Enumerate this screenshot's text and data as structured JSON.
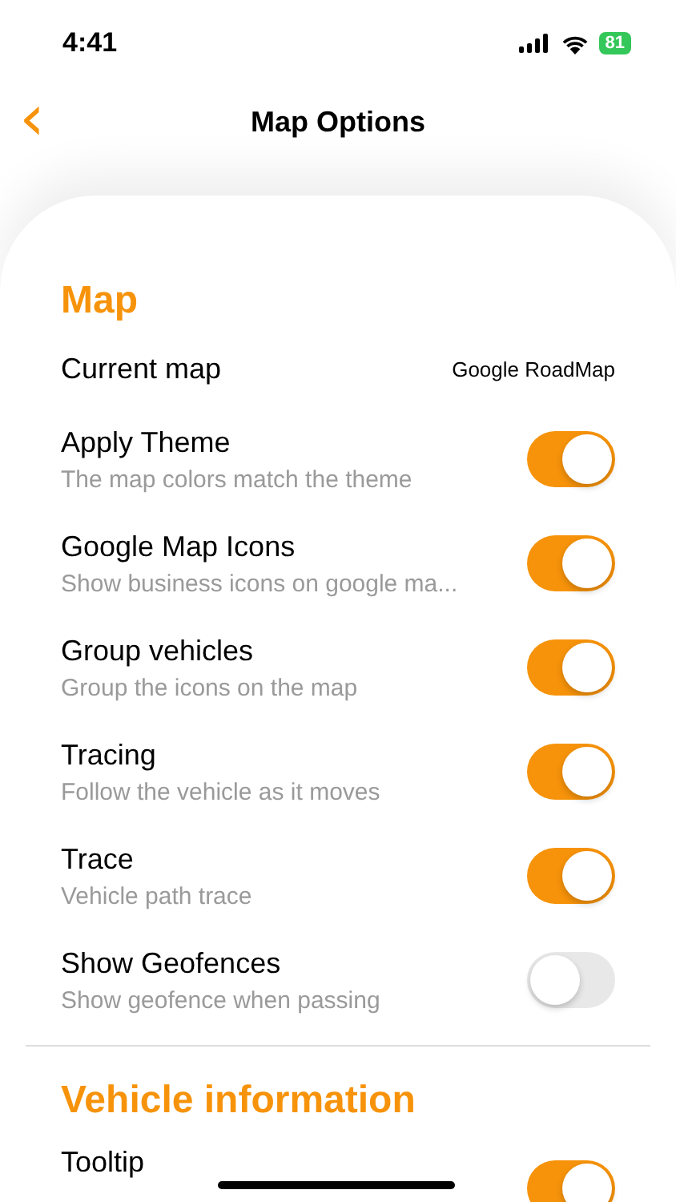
{
  "status_bar": {
    "time": "4:41",
    "battery": "81"
  },
  "nav": {
    "back": "‹",
    "title": "Map Options"
  },
  "sections": [
    {
      "title": "Map",
      "rows": [
        {
          "kind": "value",
          "label": "Current map",
          "value": "Google RoadMap"
        },
        {
          "kind": "toggle",
          "label": "Apply Theme",
          "subtitle": "The map colors match the theme",
          "on": true
        },
        {
          "kind": "toggle",
          "label": "Google Map Icons",
          "subtitle": "Show business icons on google ma...",
          "on": true
        },
        {
          "kind": "toggle",
          "label": "Group vehicles",
          "subtitle": "Group the icons on the map",
          "on": true
        },
        {
          "kind": "toggle",
          "label": "Tracing",
          "subtitle": "Follow the vehicle as it moves",
          "on": true
        },
        {
          "kind": "toggle",
          "label": "Trace",
          "subtitle": "Vehicle path trace",
          "on": true
        },
        {
          "kind": "toggle",
          "label": "Show Geofences",
          "subtitle": "Show geofence when passing",
          "on": false
        }
      ]
    },
    {
      "title": "Vehicle information",
      "rows": [
        {
          "kind": "toggle",
          "label": "Tooltip",
          "on": true
        }
      ]
    }
  ]
}
